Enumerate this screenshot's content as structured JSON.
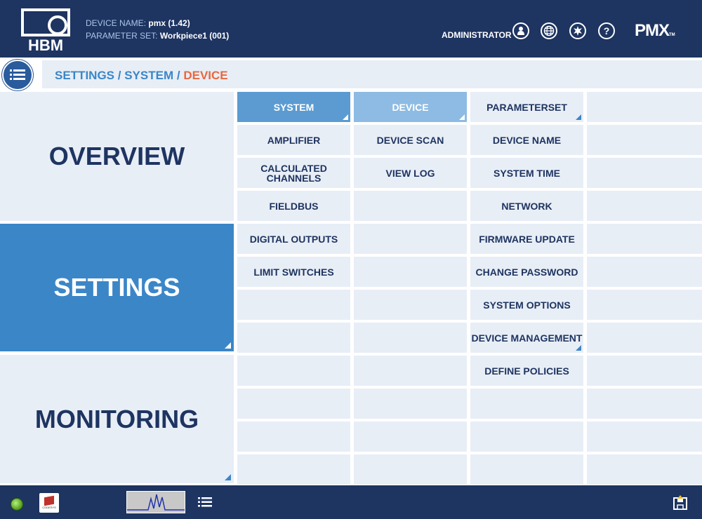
{
  "header": {
    "device_name_label": "DEVICE NAME:",
    "device_name_value": "pmx  (1.42)",
    "parameter_set_label": "PARAMETER SET:",
    "parameter_set_value": "Workpiece1 (001)",
    "user_role": "ADMINISTRATOR",
    "brand_logo": "HBM",
    "product_logo": "PMX",
    "product_logo_tm": "TM",
    "icons": [
      "user-icon",
      "globe-icon",
      "light-icon",
      "help-icon"
    ]
  },
  "breadcrumb": {
    "item1": "SETTINGS",
    "sep": "/",
    "item2": "SYSTEM",
    "current": "DEVICE"
  },
  "nav": {
    "overview": "OVERVIEW",
    "settings": "SETTINGS",
    "monitoring": "MONITORING"
  },
  "columns": {
    "col1": [
      "SYSTEM",
      "AMPLIFIER",
      "CALCULATED CHANNELS",
      "FIELDBUS",
      "DIGITAL OUTPUTS",
      "LIMIT SWITCHES",
      "",
      "",
      "",
      "",
      "",
      ""
    ],
    "col2": [
      "DEVICE",
      "DEVICE SCAN",
      "VIEW LOG",
      "",
      "",
      "",
      "",
      "",
      "",
      "",
      "",
      ""
    ],
    "col3": [
      "PARAMETERSET",
      "DEVICE NAME",
      "SYSTEM TIME",
      "NETWORK",
      "FIRMWARE UPDATE",
      "CHANGE PASSWORD",
      "SYSTEM OPTIONS",
      "DEVICE MANAGEMENT",
      "DEFINE POLICIES",
      "",
      "",
      ""
    ]
  },
  "colors": {
    "header_bg": "#1e3461",
    "accent": "#3b86c7",
    "current_crumb": "#e8683f",
    "selected_column1": "#5b9bd1",
    "selected_column2": "#8dbbe3",
    "cell_bg": "#e8eef6"
  },
  "footer": {
    "status": "status-led-green",
    "codesys_label": "CODESYS"
  }
}
